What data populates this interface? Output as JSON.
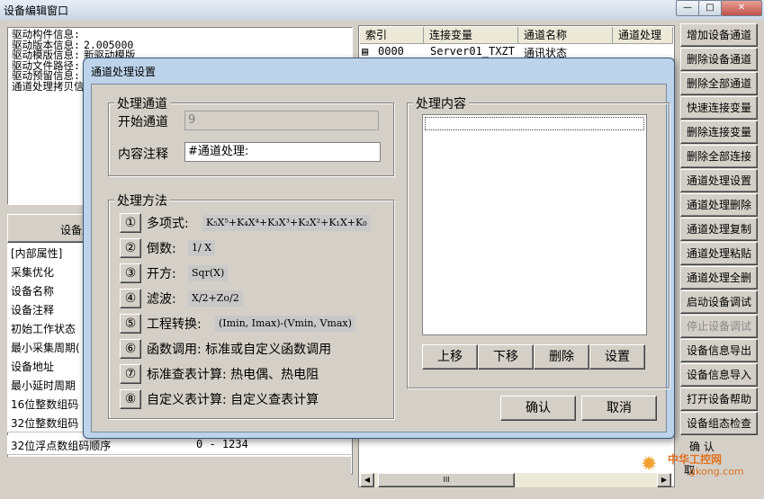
{
  "window": {
    "title": "设备编辑窗口",
    "min_label": "—",
    "max_label": "□",
    "close_label": "✕"
  },
  "driver_info": [
    {
      "label": "驱动构件信息:",
      "value": ""
    },
    {
      "label": "驱动版本信息:",
      "value": "2.005000"
    },
    {
      "label": "驱动模版信息:",
      "value": "新驱动模版"
    },
    {
      "label": "驱动文件路径:",
      "value": ""
    },
    {
      "label": "驱动预留信息:",
      "value": ""
    },
    {
      "label": "通道处理拷贝信",
      "value": ""
    }
  ],
  "props": {
    "header": "设备属",
    "rows": [
      {
        "name": "[内部属性]",
        "value": ""
      },
      {
        "name": "采集优化",
        "value": ""
      },
      {
        "name": "设备名称",
        "value": ""
      },
      {
        "name": "设备注释",
        "value": ""
      },
      {
        "name": "初始工作状态",
        "value": ""
      },
      {
        "name": "最小采集周期(",
        "value": ""
      },
      {
        "name": "设备地址",
        "value": ""
      },
      {
        "name": "最小延时周期",
        "value": ""
      },
      {
        "name": "16位整数组码",
        "value": ""
      },
      {
        "name": "32位整数组码",
        "value": ""
      },
      {
        "name": "32位浮点数组码顺序",
        "value": "0 - 1234"
      }
    ]
  },
  "channel_table": {
    "headers": [
      "索引",
      "连接变量",
      "通道名称",
      "通道处理"
    ],
    "first_row": {
      "index": "0000",
      "variable": "Server01_TXZT",
      "name": "通讯状态",
      "proc": ""
    },
    "scroll_left": "◀",
    "scroll_right": "▶",
    "scroll_grip": "III"
  },
  "right_buttons": [
    {
      "label": "增加设备通道",
      "enabled": true
    },
    {
      "label": "删除设备通道",
      "enabled": true
    },
    {
      "label": "删除全部通道",
      "enabled": true
    },
    {
      "label": "快速连接变量",
      "enabled": true
    },
    {
      "label": "删除连接变量",
      "enabled": true
    },
    {
      "label": "删除全部连接",
      "enabled": true
    },
    {
      "label": "通道处理设置",
      "enabled": true
    },
    {
      "label": "通道处理删除",
      "enabled": true
    },
    {
      "label": "通道处理复制",
      "enabled": true
    },
    {
      "label": "通道处理粘贴",
      "enabled": true
    },
    {
      "label": "通道处理全删",
      "enabled": true
    },
    {
      "label": "启动设备调试",
      "enabled": true
    },
    {
      "label": "停止设备调试",
      "enabled": false
    },
    {
      "label": "设备信息导出",
      "enabled": true
    },
    {
      "label": "设备信息导入",
      "enabled": true
    },
    {
      "label": "打开设备帮助",
      "enabled": true
    },
    {
      "label": "设备组态检查",
      "enabled": true
    }
  ],
  "bottom_right": {
    "confirm": "确  认",
    "cancel": "取"
  },
  "watermark": {
    "text": "中华工控网",
    "url": "gkong.com"
  },
  "dialog": {
    "title": "通道处理设置",
    "group_channel": {
      "title": "处理通道",
      "start_label": "开始通道",
      "start_value": "9",
      "comment_label": "内容注释",
      "comment_value": "#通道处理:"
    },
    "group_method": {
      "title": "处理方法",
      "items": [
        {
          "num": "①",
          "label": "多项式:",
          "formula": "K₅X⁵+K₄X⁴+K₃X³+K₂X²+K₁X+K₀"
        },
        {
          "num": "②",
          "label": "倒数:",
          "formula": "1/ X"
        },
        {
          "num": "③",
          "label": "开方:",
          "formula": "Sqr(X)"
        },
        {
          "num": "④",
          "label": "滤波:",
          "formula": "X/2+Zo/2"
        },
        {
          "num": "⑤",
          "label": "工程转换:",
          "formula": "(Imin, Imax)-(Vmin, Vmax)"
        },
        {
          "num": "⑥",
          "label": "函数调用: 标准或自定义函数调用",
          "formula": ""
        },
        {
          "num": "⑦",
          "label": "标准查表计算: 热电偶、热电阻",
          "formula": ""
        },
        {
          "num": "⑧",
          "label": "自定义表计算: 自定义查表计算",
          "formula": ""
        }
      ]
    },
    "group_content": {
      "title": "处理内容"
    },
    "buttons": {
      "up": "上移",
      "down": "下移",
      "delete": "删除",
      "setup": "设置",
      "ok": "确认",
      "cancel": "取消"
    }
  }
}
